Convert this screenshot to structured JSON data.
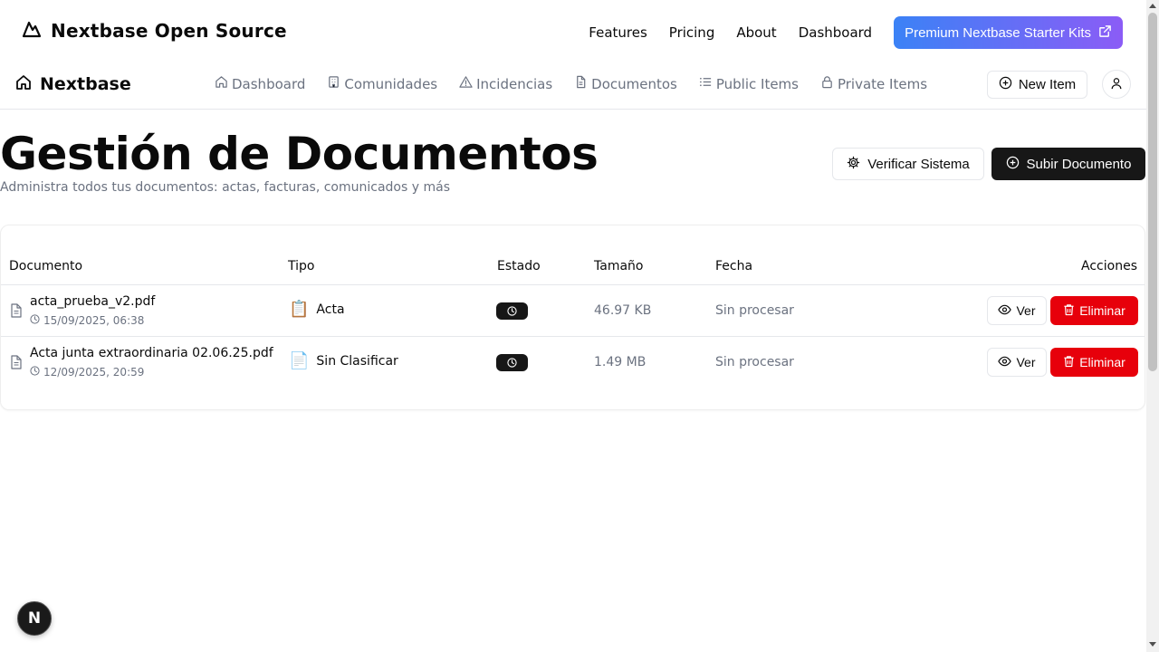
{
  "topbar": {
    "brand": "Nextbase Open Source",
    "links": [
      "Features",
      "Pricing",
      "About",
      "Dashboard"
    ],
    "premium_label": "Premium Nextbase Starter Kits"
  },
  "appbar": {
    "brand": "Nextbase",
    "nav": [
      {
        "label": "Dashboard",
        "icon": "home-icon"
      },
      {
        "label": "Comunidades",
        "icon": "building-icon"
      },
      {
        "label": "Incidencias",
        "icon": "warning-icon"
      },
      {
        "label": "Documentos",
        "icon": "file-icon"
      },
      {
        "label": "Public Items",
        "icon": "list-icon"
      },
      {
        "label": "Private Items",
        "icon": "lock-icon"
      }
    ],
    "new_item_label": "New Item"
  },
  "page": {
    "title": "Gestión de Documentos",
    "subtitle": "Administra todos tus documentos: actas, facturas, comunicados y más",
    "verify_label": "Verificar Sistema",
    "upload_label": "Subir Documento"
  },
  "table": {
    "headers": {
      "document": "Documento",
      "type": "Tipo",
      "status": "Estado",
      "size": "Tamaño",
      "date": "Fecha",
      "actions": "Acciones"
    },
    "rows": [
      {
        "name": "acta_prueba_v2.pdf",
        "uploaded": "15/09/2025, 06:38",
        "type_emoji": "📋",
        "type": "Acta",
        "status_icon": "clock-icon",
        "size": "46.97 KB",
        "date": "Sin procesar",
        "view_label": "Ver",
        "delete_label": "Eliminar"
      },
      {
        "name": "Acta junta extraordinaria 02.06.25.pdf",
        "uploaded": "12/09/2025, 20:59",
        "type_emoji": "📄",
        "type": "Sin Clasificar",
        "status_icon": "clock-icon",
        "size": "1.49 MB",
        "date": "Sin procesar",
        "view_label": "Ver",
        "delete_label": "Eliminar"
      }
    ]
  },
  "dev_badge": "N",
  "colors": {
    "primary_dark": "#171717",
    "danger": "#e7000b",
    "premium_gradient_start": "#3b82f6",
    "premium_gradient_end": "#8b5cf6",
    "muted_text": "#6b7280"
  }
}
